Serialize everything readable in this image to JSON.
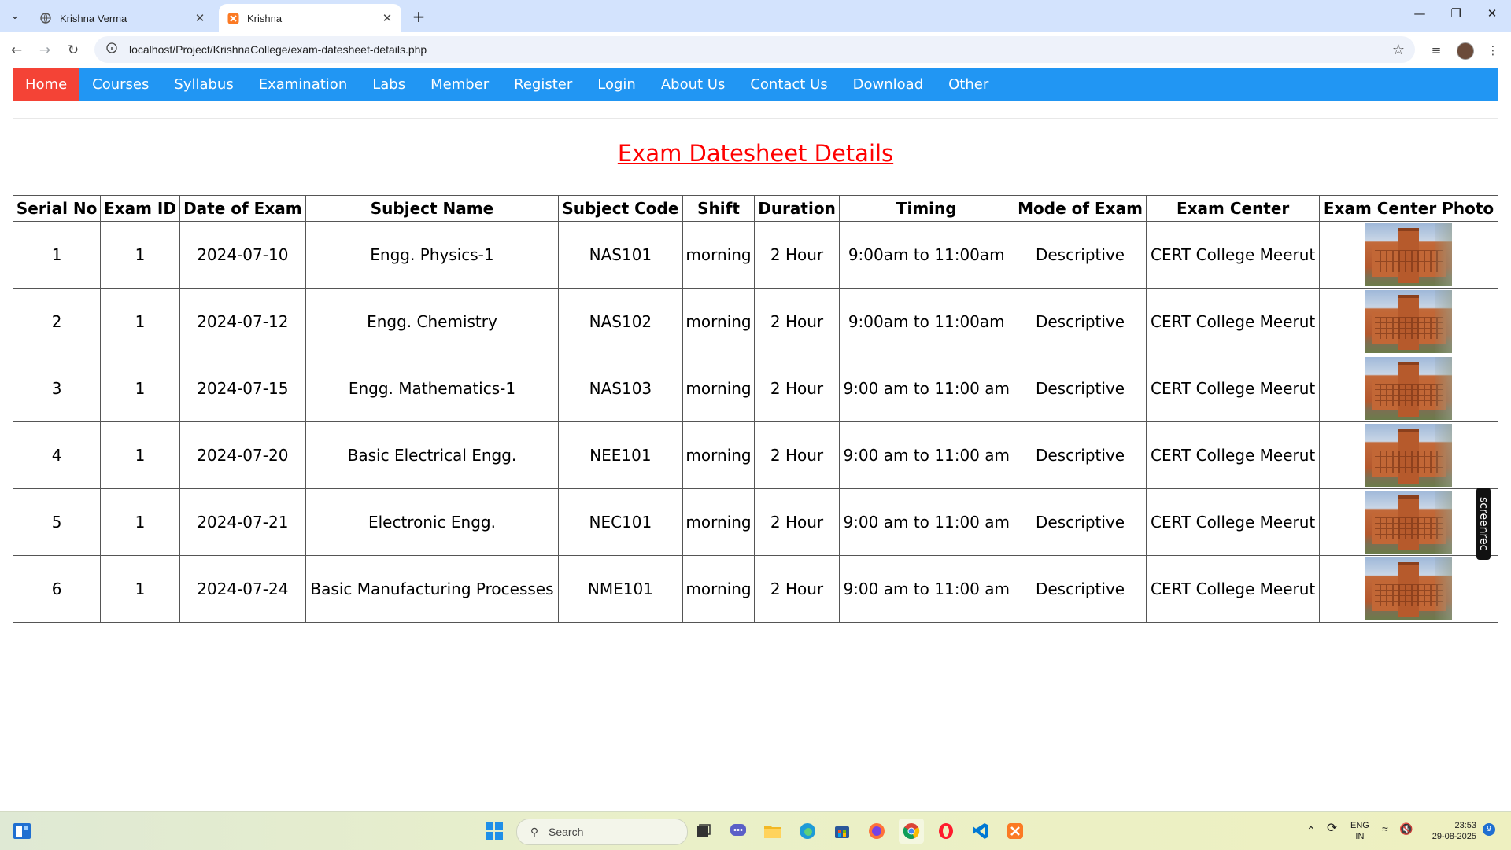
{
  "browser": {
    "tabs": [
      {
        "title": "Krishna Verma",
        "active": false
      },
      {
        "title": "Krishna",
        "active": true
      }
    ],
    "url": "localhost/Project/KrishnaCollege/exam-datesheet-details.php"
  },
  "nav": {
    "items": [
      "Home",
      "Courses",
      "Syllabus",
      "Examination",
      "Labs",
      "Member",
      "Register",
      "Login",
      "About Us",
      "Contact Us",
      "Download",
      "Other"
    ],
    "active": "Home"
  },
  "page": {
    "title": "Exam Datesheet Details"
  },
  "table": {
    "headers": [
      "Serial No",
      "Exam ID",
      "Date of Exam",
      "Subject Name",
      "Subject Code",
      "Shift",
      "Duration",
      "Timing",
      "Mode of Exam",
      "Exam Center",
      "Exam Center Photo"
    ],
    "rows": [
      [
        "1",
        "1",
        "2024-07-10",
        "Engg. Physics-1",
        "NAS101",
        "morning",
        "2 Hour",
        "9:00am to 11:00am",
        "Descriptive",
        "CERT College Meerut"
      ],
      [
        "2",
        "1",
        "2024-07-12",
        "Engg. Chemistry",
        "NAS102",
        "morning",
        "2 Hour",
        "9:00am to 11:00am",
        "Descriptive",
        "CERT College Meerut"
      ],
      [
        "3",
        "1",
        "2024-07-15",
        "Engg. Mathematics-1",
        "NAS103",
        "morning",
        "2 Hour",
        "9:00 am to 11:00 am",
        "Descriptive",
        "CERT College Meerut"
      ],
      [
        "4",
        "1",
        "2024-07-20",
        "Basic Electrical Engg.",
        "NEE101",
        "morning",
        "2 Hour",
        "9:00 am to 11:00 am",
        "Descriptive",
        "CERT College Meerut"
      ],
      [
        "5",
        "1",
        "2024-07-21",
        "Electronic Engg.",
        "NEC101",
        "morning",
        "2 Hour",
        "9:00 am to 11:00 am",
        "Descriptive",
        "CERT College Meerut"
      ],
      [
        "6",
        "1",
        "2024-07-24",
        "Basic Manufacturing Processes",
        "NME101",
        "morning",
        "2 Hour",
        "9:00 am to 11:00 am",
        "Descriptive",
        "CERT College Meerut"
      ]
    ]
  },
  "overlay": {
    "screenrec_label": "screenrec"
  },
  "taskbar": {
    "search_placeholder": "Search",
    "lang_top": "ENG",
    "lang_bottom": "IN",
    "time": "23:53",
    "date": "29-08-2025",
    "notification_count": "9"
  },
  "colors": {
    "nav_bg": "#2196f3",
    "nav_active": "#f44336",
    "title": "#ff0000"
  }
}
